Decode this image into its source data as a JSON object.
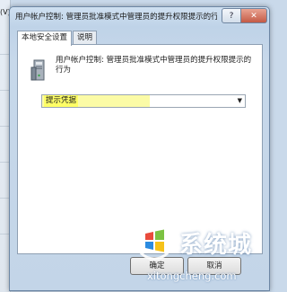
{
  "window": {
    "title": "用户帐户控制: 管理员批准模式中管理员的提升权限提示的行...",
    "left_peek": "(V)"
  },
  "title_buttons": {
    "help": "?",
    "close": "✕"
  },
  "tabs": [
    {
      "label": "本地安全设置",
      "active": true
    },
    {
      "label": "说明",
      "active": false
    }
  ],
  "policy": {
    "icon": "policy-computer-icon",
    "description": "用户帐户控制: 管理员批准模式中管理员的提升权限提示的行为"
  },
  "dropdown": {
    "selected": "提示凭据",
    "highlight_color": "#ffff66"
  },
  "buttons": {
    "ok": "确定",
    "cancel": "取消"
  },
  "watermark": {
    "brand": "系统城",
    "url": "xitongcheng.com"
  }
}
